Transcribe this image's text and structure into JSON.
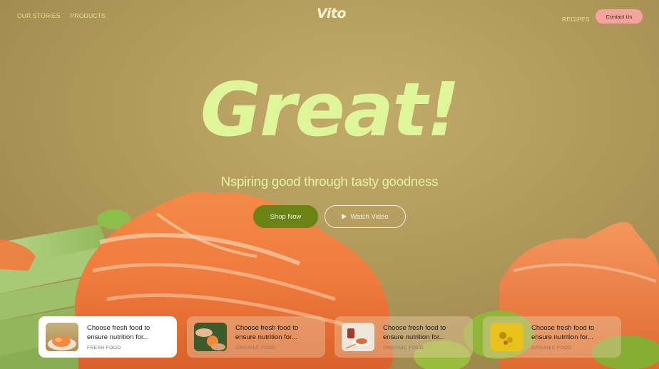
{
  "nav": {
    "left_links": [
      "OUR STORIES",
      "PRODUCTS"
    ],
    "logo": "Vito",
    "right_link": "RECIPES",
    "contact_label": "Contact Us"
  },
  "hero": {
    "headline": "Great!",
    "tagline": "Nspiring good through tasty goodness",
    "shop_label": "Shop Now",
    "watch_label": "Watch Video"
  },
  "cards": [
    {
      "title": "Choose fresh food to ensure nutrition for...",
      "tag": "FRESH FOOD",
      "active": true
    },
    {
      "title": "Choose fresh food to ensure nutrition for...",
      "tag": "ORGANIC FOOD",
      "active": false
    },
    {
      "title": "Choose fresh food to ensure nutrition for...",
      "tag": "ORGANIC FOOD",
      "active": false
    },
    {
      "title": "Choose fresh food to ensure nutrition for...",
      "tag": "ORGANIC FOOD",
      "active": false
    }
  ],
  "colors": {
    "accent_green": "#6a8315",
    "headline": "#dff59a",
    "contact_pink": "#f5a3a0",
    "salmon": "#f07a3c"
  },
  "icons": [
    "play-icon",
    "salmon-image",
    "cucumber-image",
    "avocado-image"
  ]
}
